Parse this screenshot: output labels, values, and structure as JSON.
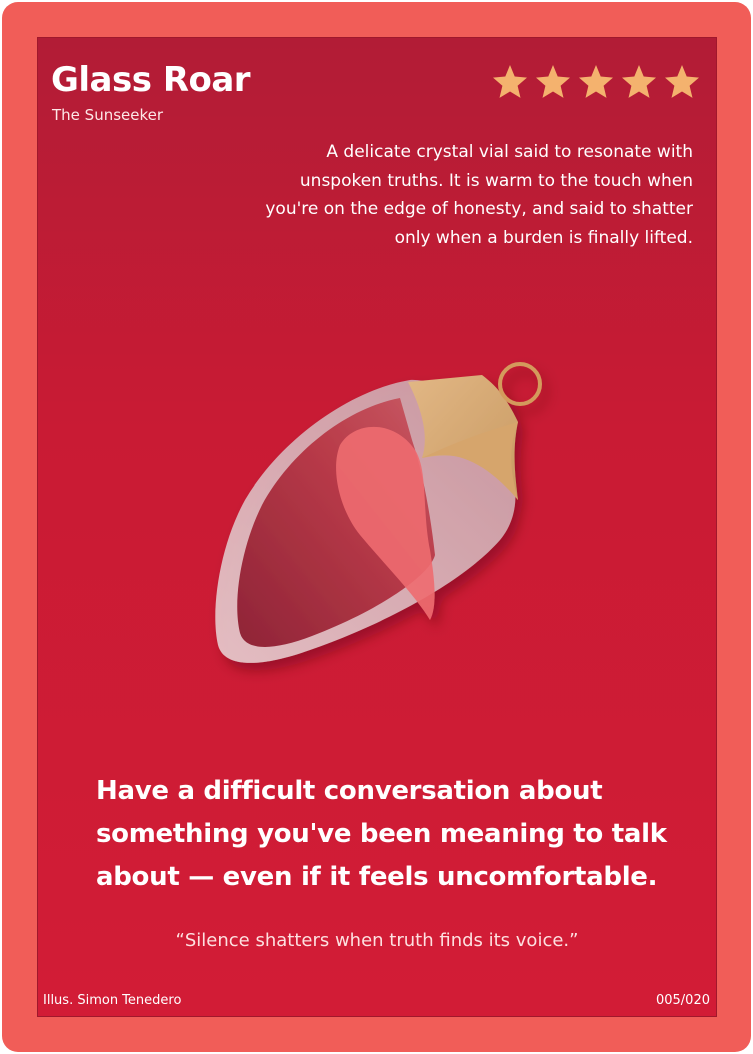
{
  "card": {
    "title": "Glass Roar",
    "subtitle": "The Sunseeker",
    "rating": 5,
    "description": "A delicate crystal vial said to resonate with unspoken truths. It is warm to the touch when you're on the edge of honesty, and said to shatter only when a burden is finally lifted.",
    "challenge": "Have a difficult conversation about something you've been meaning to talk about — even if it feels uncomfortable.",
    "quote": "“Silence shatters when truth finds its voice.”",
    "illustrator_credit": "Illus. Simon Tenedero",
    "card_number": "005/020",
    "illustration": "glass-ornament-heart-icon"
  },
  "colors": {
    "frame": "#f15d58",
    "card_top": "#b21c36",
    "card_bottom": "#d21c36",
    "star": "#f4b26e",
    "text": "#ffffff"
  }
}
